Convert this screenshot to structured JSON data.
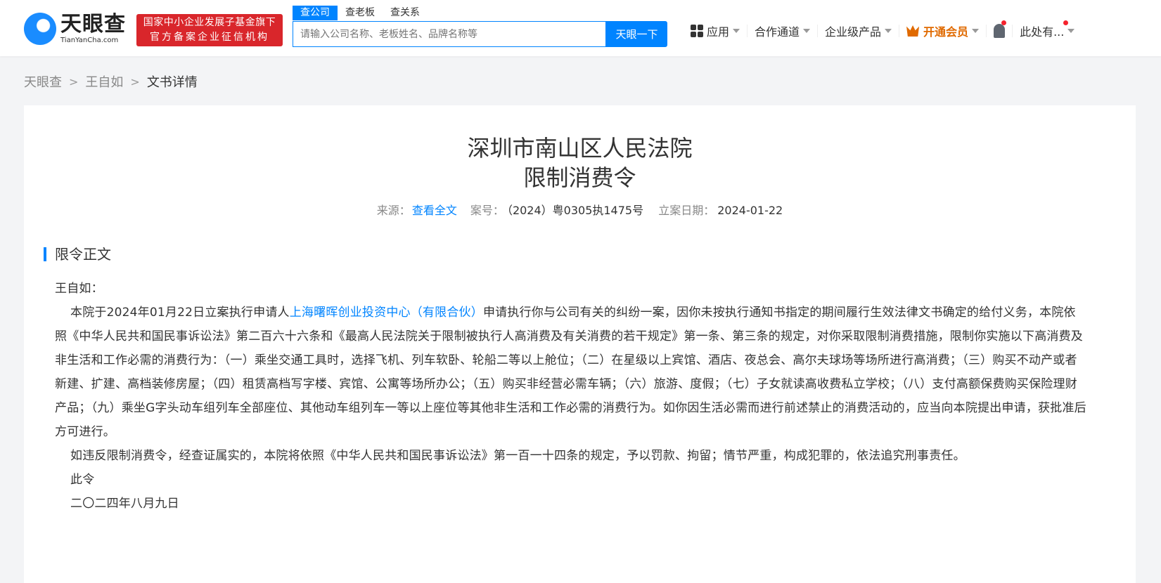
{
  "header": {
    "logo_cn": "天眼查",
    "logo_en": "TianYanCha.com",
    "badge_line1": "国家中小企业发展子基金旗下",
    "badge_line2": "官方备案企业征信机构",
    "search_tabs": [
      "查公司",
      "查老板",
      "查关系"
    ],
    "search_placeholder": "请输入公司名称、老板姓名、品牌名称等",
    "search_button": "天眼一下",
    "nav": {
      "apps": "应用",
      "channel": "合作通道",
      "enterprise": "企业级产品",
      "vip": "开通会员",
      "user": "此处有..."
    }
  },
  "breadcrumb": [
    "天眼查",
    "王自如",
    "文书详情"
  ],
  "doc": {
    "court": "深圳市南山区人民法院",
    "title": "限制消费令",
    "source_label": "来源：",
    "source_link": "查看全文",
    "case_label": "案号：",
    "case_no": "（2024）粤0305执1475号",
    "date_label": "立案日期：",
    "date": "2024-01-22",
    "section": "限令正文",
    "addressee": "王自如：",
    "p1_a": "本院于2024年01月22日立案执行申请人",
    "p1_link": "上海曙晖创业投资中心（有限合伙）",
    "p1_b": "申请执行你与公司有关的纠纷一案，因你未按执行通知书指定的期间履行生效法律文书确定的给付义务，本院依照《中华人民共和国民事诉讼法》第二百六十六条和《最高人民法院关于限制被执行人高消费及有关消费的若干规定》第一条、第三条的规定，对你采取限制消费措施，限制你实施以下高消费及非生活和工作必需的消费行为：（一）乘坐交通工具时，选择飞机、列车软卧、轮船二等以上舱位；（二）在星级以上宾馆、酒店、夜总会、高尔夫球场等场所进行高消费；（三）购买不动产或者新建、扩建、高档装修房屋；（四）租赁高档写字楼、宾馆、公寓等场所办公；（五）购买非经营必需车辆；（六）旅游、度假；（七）子女就读高收费私立学校；（八）支付高额保费购买保险理财产品；（九）乘坐G字头动车组列车全部座位、其他动车组列车一等以上座位等其他非生活和工作必需的消费行为。如你因生活必需而进行前述禁止的消费活动的，应当向本院提出申请，获批准后方可进行。",
    "p2": "如违反限制消费令，经查证属实的，本院将依照《中华人民共和国民事诉讼法》第一百一十四条的规定，予以罚款、拘留；情节严重，构成犯罪的，依法追究刑事责任。",
    "p3": "此令",
    "p4": "二〇二四年八月九日"
  }
}
